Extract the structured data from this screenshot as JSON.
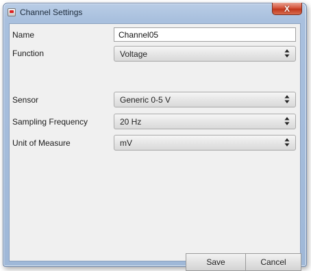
{
  "window": {
    "title": "Channel Settings",
    "close_glyph": "X"
  },
  "form": {
    "name": {
      "label": "Name",
      "value": "Channel05"
    },
    "function": {
      "label": "Function",
      "value": "Voltage"
    },
    "sensor": {
      "label": "Sensor",
      "value": "Generic 0-5 V"
    },
    "sampling_frequency": {
      "label": "Sampling Frequency",
      "value": "20 Hz"
    },
    "unit_of_measure": {
      "label": "Unit of Measure",
      "value": "mV"
    }
  },
  "buttons": {
    "save": "Save",
    "cancel": "Cancel"
  },
  "icons": {
    "app": "app-icon",
    "close": "close-icon",
    "dropdown": "updown-arrow-icon"
  },
  "colors": {
    "titlebar": "#a9c0de",
    "close_button": "#c1371c",
    "client_background": "#f0f0f0"
  }
}
